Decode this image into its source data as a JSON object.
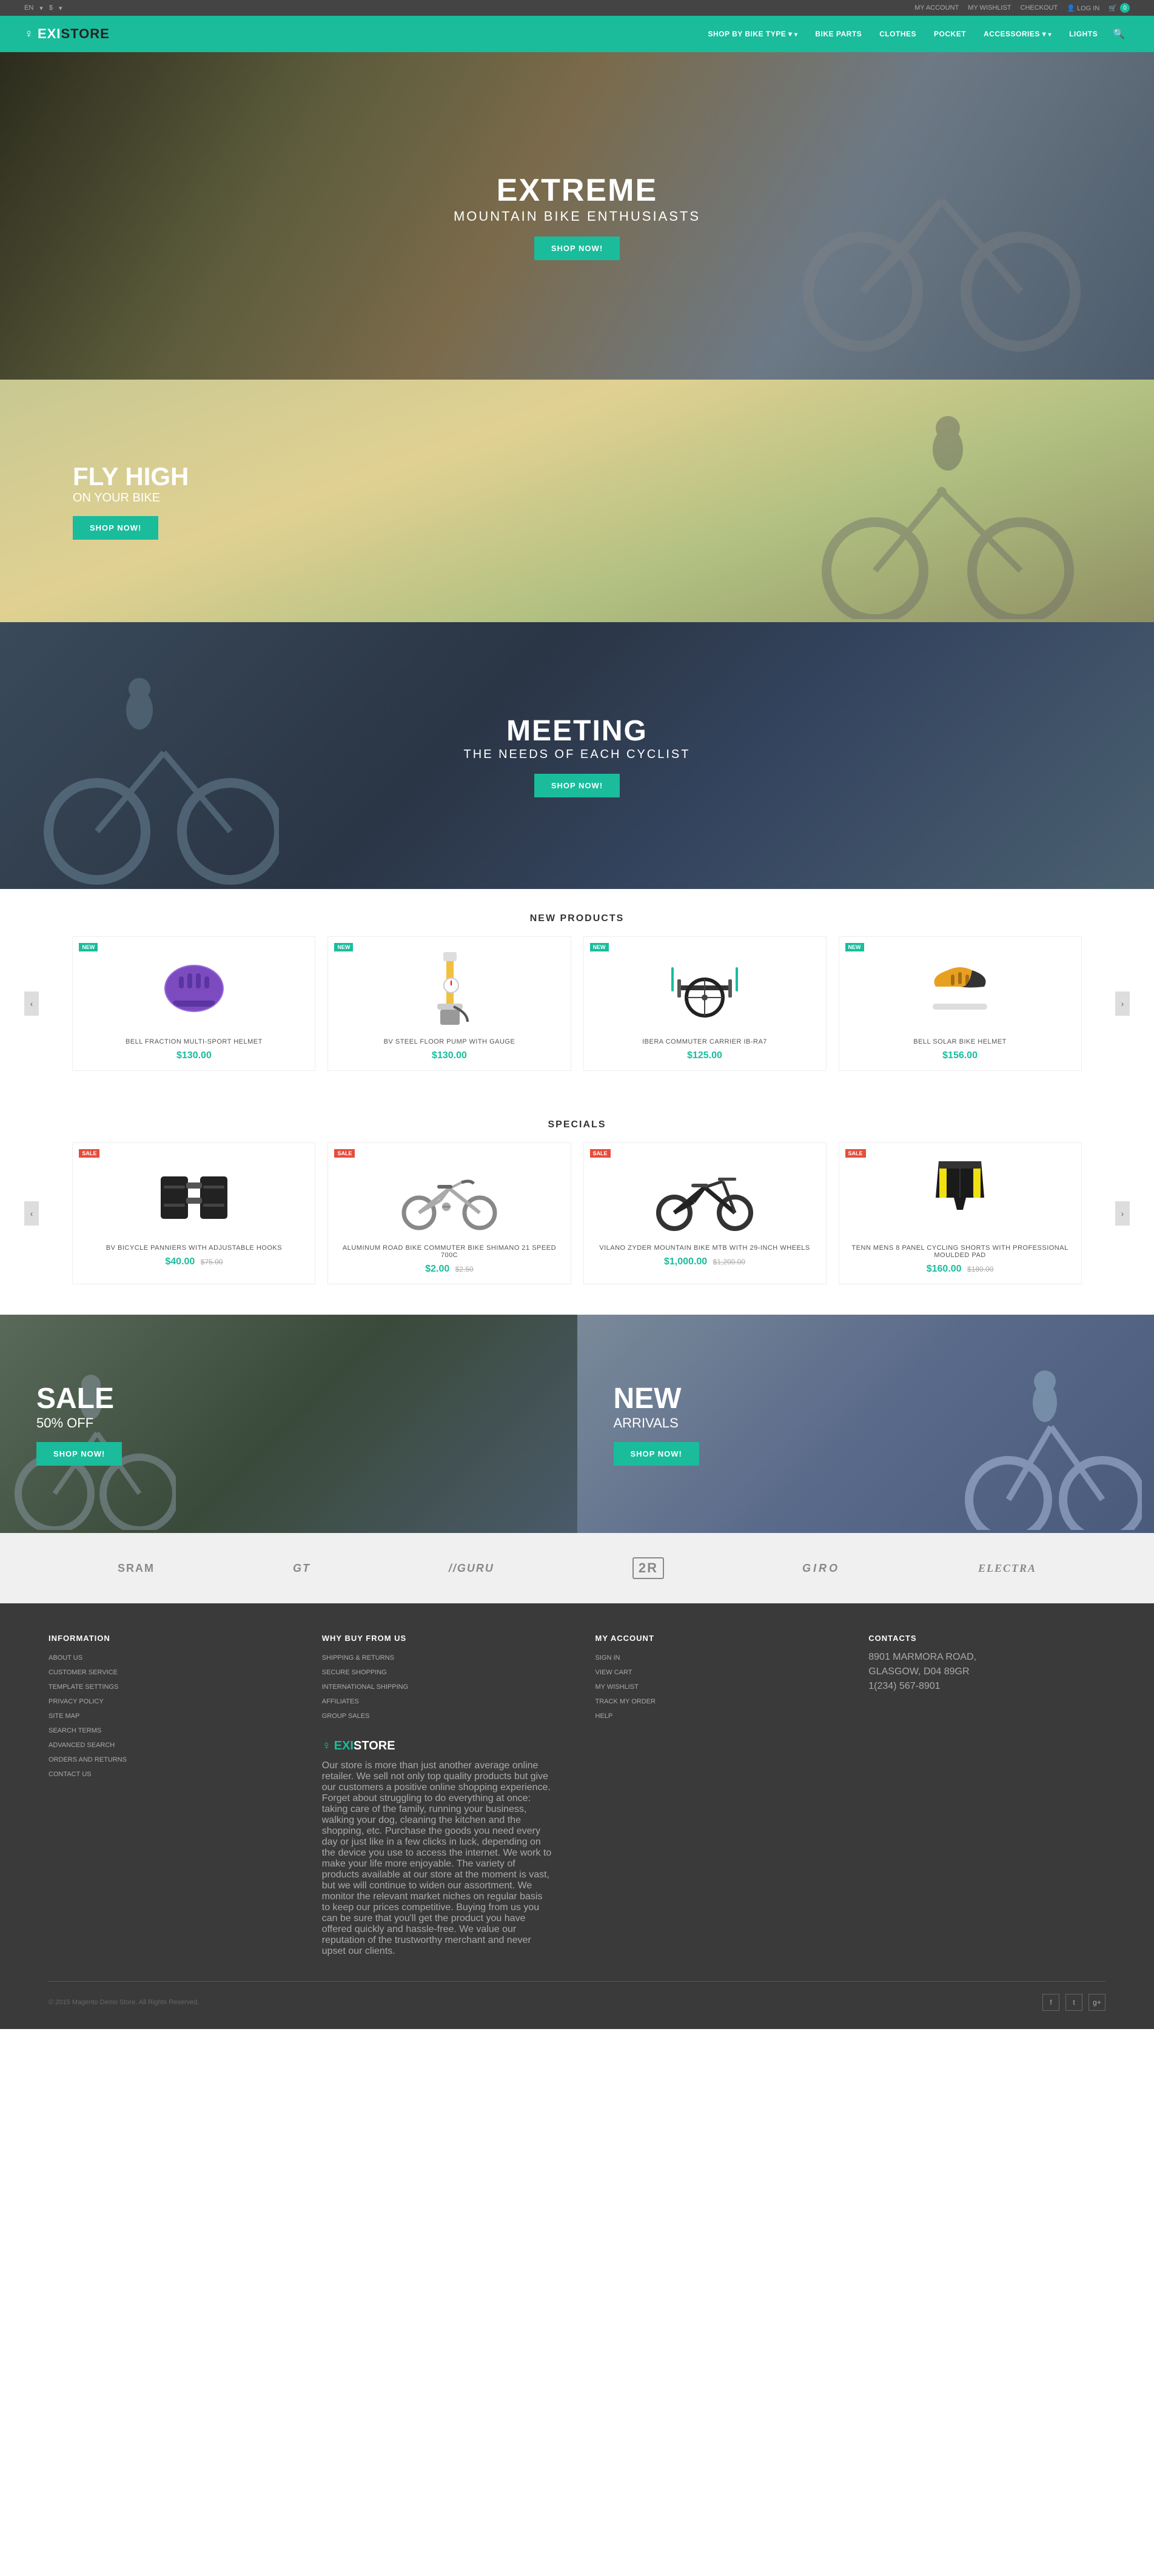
{
  "topbar": {
    "lang": "EN",
    "links": [
      "MY ACCOUNT",
      "MY WISHLIST",
      "CHECKOUT",
      "LOG IN"
    ],
    "cart_count": "0"
  },
  "header": {
    "logo": "EXISTORE",
    "logo_icon": "♀",
    "nav_items": [
      {
        "label": "SHOP BY BIKE TYPE",
        "has_arrow": true
      },
      {
        "label": "BIKE PARTS",
        "has_arrow": false
      },
      {
        "label": "CLOTHES",
        "has_arrow": false
      },
      {
        "label": "POCKET",
        "has_arrow": false
      },
      {
        "label": "ACCESSORIES",
        "has_arrow": true
      },
      {
        "label": "LIGHTS",
        "has_arrow": false
      }
    ]
  },
  "hero1": {
    "title": "EXTREME",
    "subtitle": "MOUNTAIN BIKE ENTHUSIASTS",
    "btn": "SHOP NOW!"
  },
  "hero2": {
    "title": "FLY HIGH",
    "subtitle": "ON YOUR BIKE",
    "btn": "SHOP NOW!"
  },
  "hero3": {
    "title": "MEETING",
    "subtitle": "THE NEEDS OF EACH CYCLIST",
    "btn": "SHOP NOW!"
  },
  "new_products": {
    "section_title": "NEW PRODUCTS",
    "items": [
      {
        "badge": "NEW",
        "badge_type": "new",
        "name": "BELL FRACTION MULTI-SPORT HELMET",
        "price": "$130.00",
        "price_old": "",
        "color": "#7c4bc0"
      },
      {
        "badge": "NEW",
        "badge_type": "new",
        "name": "BV STEEL FLOOR PUMP WITH GAUGE",
        "price": "$130.00",
        "price_old": "",
        "color": "#f0c040"
      },
      {
        "badge": "NEW",
        "badge_type": "new",
        "name": "IBERA COMMUTER CARRIER IB-RA7",
        "price": "$125.00",
        "price_old": "",
        "color": "#333"
      },
      {
        "badge": "NEW",
        "badge_type": "new",
        "name": "BELL SOLAR BIKE HELMET",
        "price": "$156.00",
        "price_old": "",
        "color": "#e8a020"
      }
    ]
  },
  "specials": {
    "section_title": "SPECIALS",
    "items": [
      {
        "badge": "SALE",
        "badge_type": "sale",
        "name": "BV BICYCLE PANNIERS WITH ADJUSTABLE HOOKS",
        "price": "$40.00",
        "price_old": "$75.00",
        "color": "#222"
      },
      {
        "badge": "SALE",
        "badge_type": "sale",
        "name": "ALUMINUM ROAD BIKE COMMUTER BIKE SHIMANO 21 SPEED 700C",
        "price": "$2.00",
        "price_old": "$2.50",
        "color": "#888"
      },
      {
        "badge": "SALE",
        "badge_type": "sale",
        "name": "VILANO ZYDER MOUNTAIN BIKE MTB WITH 29-INCH WHEELS",
        "price": "$1,000.00",
        "price_old": "$1,200.00",
        "color": "#222"
      },
      {
        "badge": "SALE",
        "badge_type": "sale",
        "name": "TENN MENS 8 PANEL CYCLING SHORTS WITH PROFESSIONAL MOULDED PAD",
        "price": "$160.00",
        "price_old": "$180.00",
        "color": "#1a1a1a"
      }
    ]
  },
  "promo": {
    "sale_title": "SALE",
    "sale_subtitle": "50% OFF",
    "sale_btn": "SHOP NOW!",
    "new_title": "NEW",
    "new_subtitle": "ARRIVALS",
    "new_btn": "SHOP NOW!"
  },
  "brands": [
    "SRAM",
    "GT",
    "GURU",
    "2R",
    "GIRO",
    "Electra"
  ],
  "footer": {
    "col1_title": "INFORMATION",
    "col1_links": [
      "ABOUT US",
      "CUSTOMER SERVICE",
      "TEMPLATE SETTINGS",
      "PRIVACY POLICY",
      "SITE MAP",
      "SEARCH TERMS",
      "ADVANCED SEARCH",
      "ORDERS AND RETURNS",
      "CONTACT US"
    ],
    "col2_title": "WHY BUY FROM US",
    "col2_links": [
      "SHIPPING & RETURNS",
      "SECURE SHOPPING",
      "INTERNATIONAL SHIPPING",
      "AFFILIATES",
      "GROUP SALES"
    ],
    "col3_title": "MY ACCOUNT",
    "col3_links": [
      "SIGN IN",
      "VIEW CART",
      "MY WISHLIST",
      "TRACK MY ORDER",
      "HELP"
    ],
    "col4_title": "CONTACTS",
    "col4_links": [
      "8901 MARMORA ROAD,",
      "GLASGOW, D04 89GR",
      "1(234) 567-8901"
    ],
    "about_title": "EXISTORE",
    "about_text": "Our store is more than just another average online retailer. We sell not only top quality products but give our customers a positive online shopping experience. Forget about struggling to do everything at once: taking care of the family, running your business, walking your dog, cleaning the kitchen and the shopping, etc. Purchase the goods you need every day or just like in a few clicks in luck, depending on the device you use to access the internet. We work to make your life more enjoyable. The variety of products available at our store at the moment is vast, but we will continue to widen our assortment. We monitor the relevant market niches on regular basis to keep our prices competitive. Buying from us you can be sure that you'll get the product you have offered quickly and hassle-free. We value our reputation of the trustworthy merchant and never upset our clients.",
    "copyright": "© 2015 Magento Demo Store. All Rights Reserved.",
    "social": [
      "f",
      "t",
      "g+"
    ]
  }
}
